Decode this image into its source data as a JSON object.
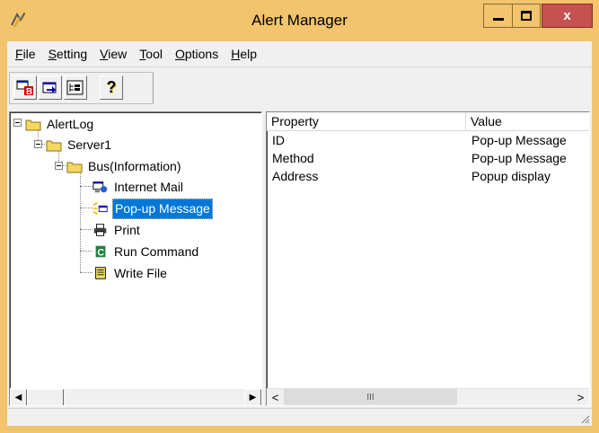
{
  "window": {
    "title": "Alert Manager",
    "close_glyph": "x"
  },
  "menu": [
    {
      "label": "File",
      "mnemonic": "F",
      "rest": "ile"
    },
    {
      "label": "Setting",
      "mnemonic": "S",
      "rest": "etting"
    },
    {
      "label": "View",
      "mnemonic": "V",
      "rest": "iew"
    },
    {
      "label": "Tool",
      "mnemonic": "T",
      "rest": "ool"
    },
    {
      "label": "Options",
      "mnemonic": "O",
      "rest": "ptions"
    },
    {
      "label": "Help",
      "mnemonic": "H",
      "rest": "elp"
    }
  ],
  "toolbar": {
    "buttons": [
      {
        "icon": "new-bus-icon",
        "badge": "B"
      },
      {
        "icon": "new-item-icon"
      },
      {
        "icon": "tree-view-icon"
      },
      {
        "icon": "help-icon",
        "glyph": "?"
      }
    ]
  },
  "tree": {
    "root": "AlertLog",
    "server": "Server1",
    "bus": "Bus(Information)",
    "items": [
      {
        "label": "Internet Mail",
        "icon": "internet-mail-icon"
      },
      {
        "label": "Pop-up Message",
        "icon": "popup-message-icon",
        "selected": true
      },
      {
        "label": "Print",
        "icon": "printer-icon"
      },
      {
        "label": "Run Command",
        "icon": "run-command-icon"
      },
      {
        "label": "Write File",
        "icon": "write-file-icon"
      }
    ]
  },
  "list": {
    "columns": [
      "Property",
      "Value"
    ],
    "rows": [
      {
        "property": "ID",
        "value": "Pop-up Message"
      },
      {
        "property": "Method",
        "value": "Pop-up Message"
      },
      {
        "property": "Address",
        "value": "Popup display"
      }
    ]
  },
  "scroll_glyphs": {
    "left": "◀",
    "right": "▶",
    "left_thin": "<",
    "right_thin": ">",
    "thumb": "III"
  },
  "colors": {
    "title_bar": "#f2c46d",
    "selection": "#0078d7",
    "close_button": "#c75050"
  }
}
